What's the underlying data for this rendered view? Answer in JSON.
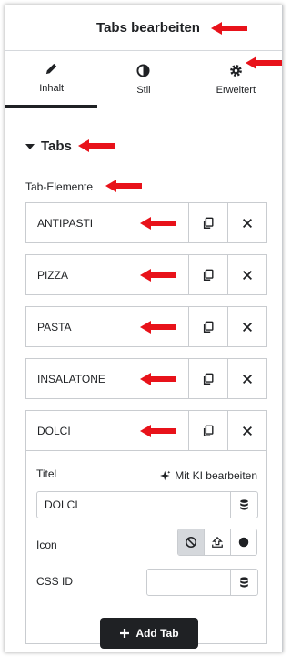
{
  "header": {
    "title": "Tabs bearbeiten"
  },
  "tabs": [
    {
      "label": "Inhalt",
      "icon": "pencil-icon",
      "active": true
    },
    {
      "label": "Stil",
      "icon": "contrast-icon",
      "active": false
    },
    {
      "label": "Erweitert",
      "icon": "gear-icon",
      "active": false
    }
  ],
  "section": {
    "title": "Tabs",
    "elements_label": "Tab-Elemente"
  },
  "items": [
    {
      "label": "ANTIPASTI"
    },
    {
      "label": "PIZZA"
    },
    {
      "label": "PASTA"
    },
    {
      "label": "INSALATONE"
    },
    {
      "label": "DOLCI"
    }
  ],
  "editor": {
    "title_label": "Titel",
    "ai_link": "Mit KI bearbeiten",
    "title_value": "DOLCI",
    "icon_label": "Icon",
    "css_id_label": "CSS ID",
    "css_id_value": ""
  },
  "add_button": {
    "label": "Add Tab"
  },
  "colors": {
    "annotation_arrow": "#e8121a",
    "dark": "#1f2124",
    "border": "#c9ccd0"
  }
}
